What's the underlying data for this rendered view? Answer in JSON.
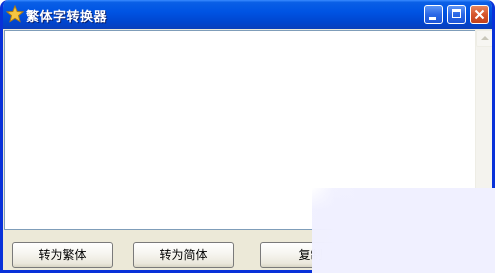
{
  "window": {
    "title": "繁体字转换器",
    "app_icon": "star-icon",
    "controls": {
      "minimize": "minimize-icon",
      "maximize": "maximize-icon",
      "close": "close-icon"
    }
  },
  "editor": {
    "value": ""
  },
  "buttons": {
    "to_traditional": "转为繁体",
    "to_simplified": "转为简体",
    "copy": "复制"
  },
  "colors": {
    "titlebar": "#0054e3",
    "window_border": "#0831d9",
    "face": "#ece9d8",
    "close_button": "#d6552b"
  }
}
